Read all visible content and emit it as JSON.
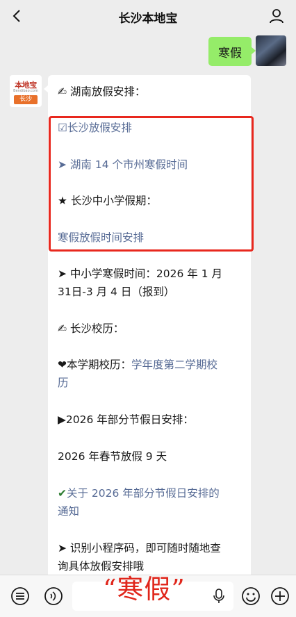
{
  "header": {
    "title": "长沙本地宝"
  },
  "user_message": {
    "text": "寒假"
  },
  "bot_avatar": {
    "logo_text": "本地宝",
    "logo_sub": "Bendibao.com",
    "city": "长沙"
  },
  "bot_message": {
    "lines": [
      "✍ 湖南放假安排：",
      "☑长沙放假安排",
      "➤ 湖南 14 个市州寒假时间",
      "★ 长沙中小学假期：",
      "寒假放假时间安排",
      "➤ 中小学寒假时间：2026 年 1 月",
      "31日-3 月 4 日（报到）",
      "✍ 长沙校历：",
      "❤本学期校历：",
      "学年度第二学期校",
      "历",
      "▶2026 年部分节假日安排：",
      "2026 年春节放假 9 天",
      "✔",
      "关于 2026 年部分节假日安排的",
      "通知",
      "➤ 识别小程序码，即可随时随地查",
      "询具体放假安排哦"
    ]
  },
  "overlay_caption": "“寒假”",
  "icons": {
    "back": "chevron-left-icon",
    "user": "person-icon",
    "menu": "list-icon",
    "voice": "voice-icon",
    "mic": "microphone-icon",
    "emoji": "emoji-icon",
    "add": "plus-icon"
  },
  "colors": {
    "link": "#576b95",
    "user_bubble": "#95ec69",
    "highlight": "#e8281e"
  }
}
